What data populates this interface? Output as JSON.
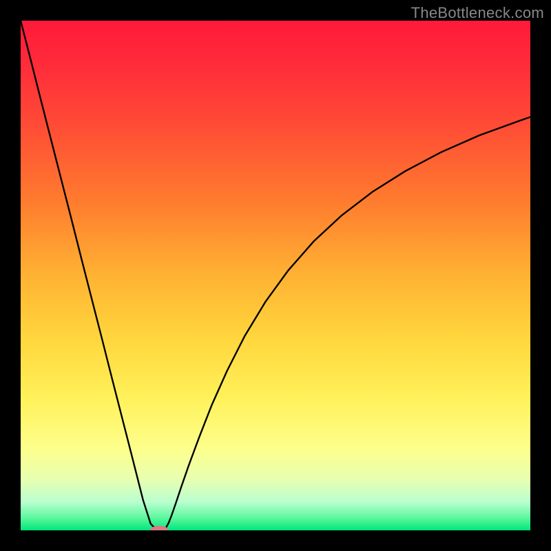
{
  "watermark": "TheBottleneck.com",
  "chart_data": {
    "type": "line",
    "title": "",
    "xlabel": "",
    "ylabel": "",
    "xlim": [
      0,
      100
    ],
    "ylim": [
      0,
      100
    ],
    "gradient_stops": [
      {
        "offset": 0.0,
        "color": "#ff1a3a"
      },
      {
        "offset": 0.08,
        "color": "#ff2a3a"
      },
      {
        "offset": 0.2,
        "color": "#ff4a36"
      },
      {
        "offset": 0.35,
        "color": "#ff7a2e"
      },
      {
        "offset": 0.5,
        "color": "#ffb233"
      },
      {
        "offset": 0.62,
        "color": "#ffd53c"
      },
      {
        "offset": 0.74,
        "color": "#fff15a"
      },
      {
        "offset": 0.84,
        "color": "#fdff8c"
      },
      {
        "offset": 0.9,
        "color": "#e8ffb0"
      },
      {
        "offset": 0.945,
        "color": "#b8ffd0"
      },
      {
        "offset": 0.975,
        "color": "#5ef79e"
      },
      {
        "offset": 1.0,
        "color": "#00e77a"
      }
    ],
    "series": [
      {
        "name": "bottleneck-curve",
        "x": [
          0,
          2,
          4,
          6,
          8,
          10,
          12,
          14,
          16,
          18,
          20,
          22,
          24,
          25.5,
          26.5,
          27.2,
          27.6,
          28.0,
          28.5,
          29.0,
          29.6,
          30.4,
          31.5,
          33.0,
          35.0,
          37.5,
          40.5,
          44.0,
          48.0,
          52.5,
          57.5,
          63.0,
          69.0,
          75.5,
          82.5,
          90.0,
          98.0,
          100.0
        ],
        "values": [
          100,
          92.2,
          84.3,
          76.5,
          68.7,
          60.9,
          53.0,
          45.2,
          37.4,
          29.5,
          21.7,
          13.9,
          6.0,
          1.3,
          0.25,
          0.02,
          0.0,
          0.08,
          0.5,
          1.4,
          2.9,
          5.2,
          8.5,
          12.8,
          18.2,
          24.6,
          31.3,
          38.2,
          44.8,
          51.0,
          56.7,
          61.8,
          66.4,
          70.5,
          74.2,
          77.5,
          80.4,
          81.1
        ]
      }
    ],
    "marker": {
      "x": 27.2,
      "y": 0.0,
      "rx": 1.8,
      "ry": 0.9,
      "color": "#d97a86"
    }
  }
}
